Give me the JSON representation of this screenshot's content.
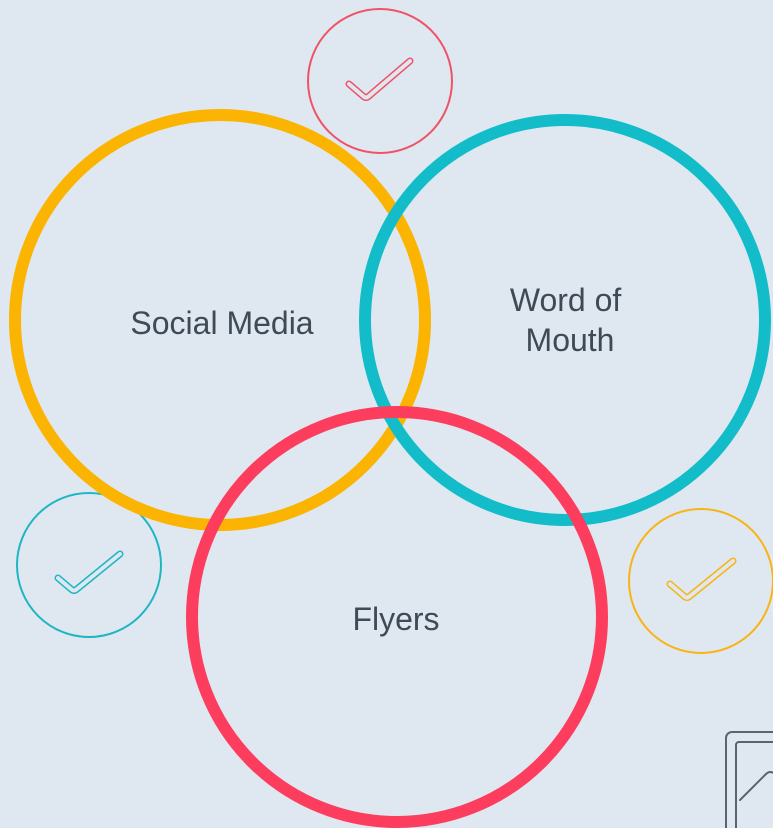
{
  "diagram": {
    "type": "venn",
    "background_color": "#dfe8f0",
    "circles": [
      {
        "id": "social-media",
        "label_lines": [
          "Social Media"
        ],
        "color": "#fbb401"
      },
      {
        "id": "word-of-mouth",
        "label_lines": [
          "Word of",
          "Mouth"
        ],
        "color": "#12bdc9"
      },
      {
        "id": "flyers",
        "label_lines": [
          "Flyers"
        ],
        "color": "#fc3d5e"
      }
    ],
    "check_badges": [
      {
        "id": "top",
        "color": "#f05266",
        "icon": "checkmark-icon"
      },
      {
        "id": "left",
        "color": "#1eb6c3",
        "icon": "checkmark-icon"
      },
      {
        "id": "right",
        "color": "#f8b414",
        "icon": "checkmark-icon"
      }
    ],
    "corner_icon": {
      "icon": "document-chart-icon",
      "color": "#5a6470"
    }
  }
}
